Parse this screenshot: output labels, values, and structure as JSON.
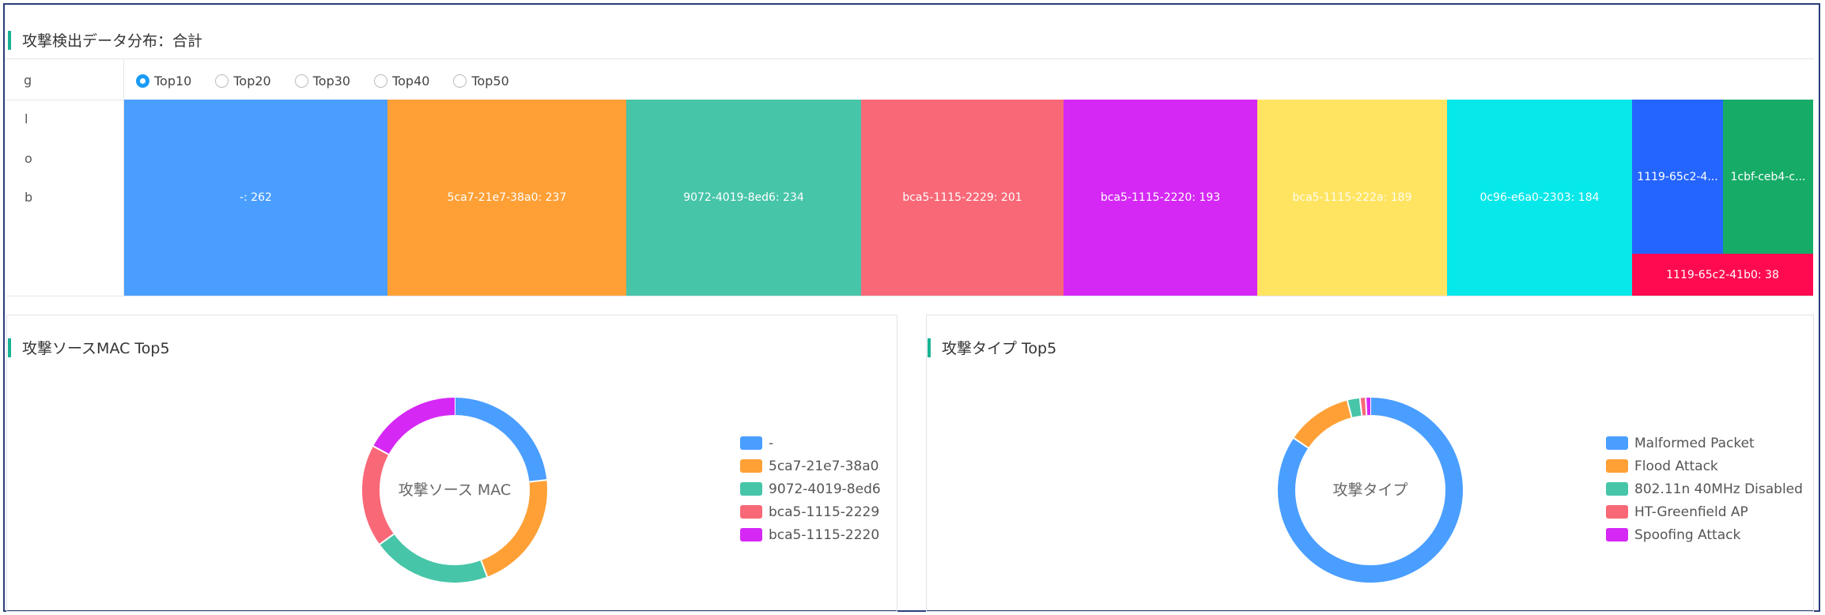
{
  "top": {
    "title": "攻撃検出データ分布：合計",
    "axis_letters": [
      "g",
      "l",
      "o",
      "b"
    ],
    "radio_options": [
      "Top10",
      "Top20",
      "Top30",
      "Top40",
      "Top50"
    ],
    "selected_option": "Top10",
    "treemap": [
      {
        "label": "-: 262",
        "value": 262,
        "color": "#4a9eff"
      },
      {
        "label": "5ca7-21e7-38a0: 237",
        "value": 237,
        "color": "#ffa036"
      },
      {
        "label": "9072-4019-8ed6: 234",
        "value": 234,
        "color": "#47c5a8"
      },
      {
        "label": "bca5-1115-2229: 201",
        "value": 201,
        "color": "#f96877"
      },
      {
        "label": "bca5-1115-2220: 193",
        "value": 193,
        "color": "#d528f5"
      },
      {
        "label": "bca5-1115-222a: 189",
        "value": 189,
        "color": "#ffe462"
      },
      {
        "label": "0c96-e6a0-2303: 184",
        "value": 184,
        "color": "#06e8ea"
      },
      {
        "label": "1119-65c2-4...",
        "value": null,
        "color": "#2565ff"
      },
      {
        "label": "1cbf-ceb4-c...",
        "value": null,
        "color": "#16ac68"
      },
      {
        "label": "1119-65c2-41b0: 38",
        "value": 38,
        "color": "#ff0a50"
      }
    ]
  },
  "mac_panel": {
    "title": "攻撃ソースMAC Top5",
    "center_label": "攻撃ソース MAC",
    "legend": [
      {
        "label": "-",
        "color": "#4a9eff"
      },
      {
        "label": "5ca7-21e7-38a0",
        "color": "#ffa036"
      },
      {
        "label": "9072-4019-8ed6",
        "color": "#47c5a8"
      },
      {
        "label": "bca5-1115-2229",
        "color": "#f96877"
      },
      {
        "label": "bca5-1115-2220",
        "color": "#d528f5"
      }
    ]
  },
  "type_panel": {
    "title": "攻撃タイプ Top5",
    "center_label": "攻撃タイプ",
    "legend": [
      {
        "label": "Malformed Packet",
        "color": "#4a9eff"
      },
      {
        "label": "Flood Attack",
        "color": "#ffa036"
      },
      {
        "label": "802.11n 40MHz Disabled",
        "color": "#47c5a8"
      },
      {
        "label": "HT-Greenfield AP",
        "color": "#f96877"
      },
      {
        "label": "Spoofing Attack",
        "color": "#d528f5"
      }
    ]
  },
  "chart_data": [
    {
      "type": "treemap",
      "title": "攻撃検出データ分布：合計",
      "labels": [
        "-",
        "5ca7-21e7-38a0",
        "9072-4019-8ed6",
        "bca5-1115-2229",
        "bca5-1115-2220",
        "bca5-1115-222a",
        "0c96-e6a0-2303",
        "1119-65c2-4...",
        "1cbf-ceb4-c...",
        "1119-65c2-41b0"
      ],
      "values": [
        262,
        237,
        234,
        201,
        193,
        189,
        184,
        59,
        55,
        38
      ]
    },
    {
      "type": "pie",
      "title": "攻撃ソースMAC Top5",
      "categories": [
        "-",
        "5ca7-21e7-38a0",
        "9072-4019-8ed6",
        "bca5-1115-2229",
        "bca5-1115-2220"
      ],
      "values": [
        262,
        237,
        234,
        201,
        193
      ],
      "colors": [
        "#4a9eff",
        "#ffa036",
        "#47c5a8",
        "#f96877",
        "#d528f5"
      ]
    },
    {
      "type": "pie",
      "title": "攻撃タイプ Top5",
      "categories": [
        "Malformed Packet",
        "Flood Attack",
        "802.11n 40MHz Disabled",
        "HT-Greenfield AP",
        "Spoofing Attack"
      ],
      "values": [
        84.5,
        11.5,
        2.2,
        1.0,
        0.8
      ],
      "colors": [
        "#4a9eff",
        "#ffa036",
        "#47c5a8",
        "#f96877",
        "#d528f5"
      ]
    }
  ]
}
